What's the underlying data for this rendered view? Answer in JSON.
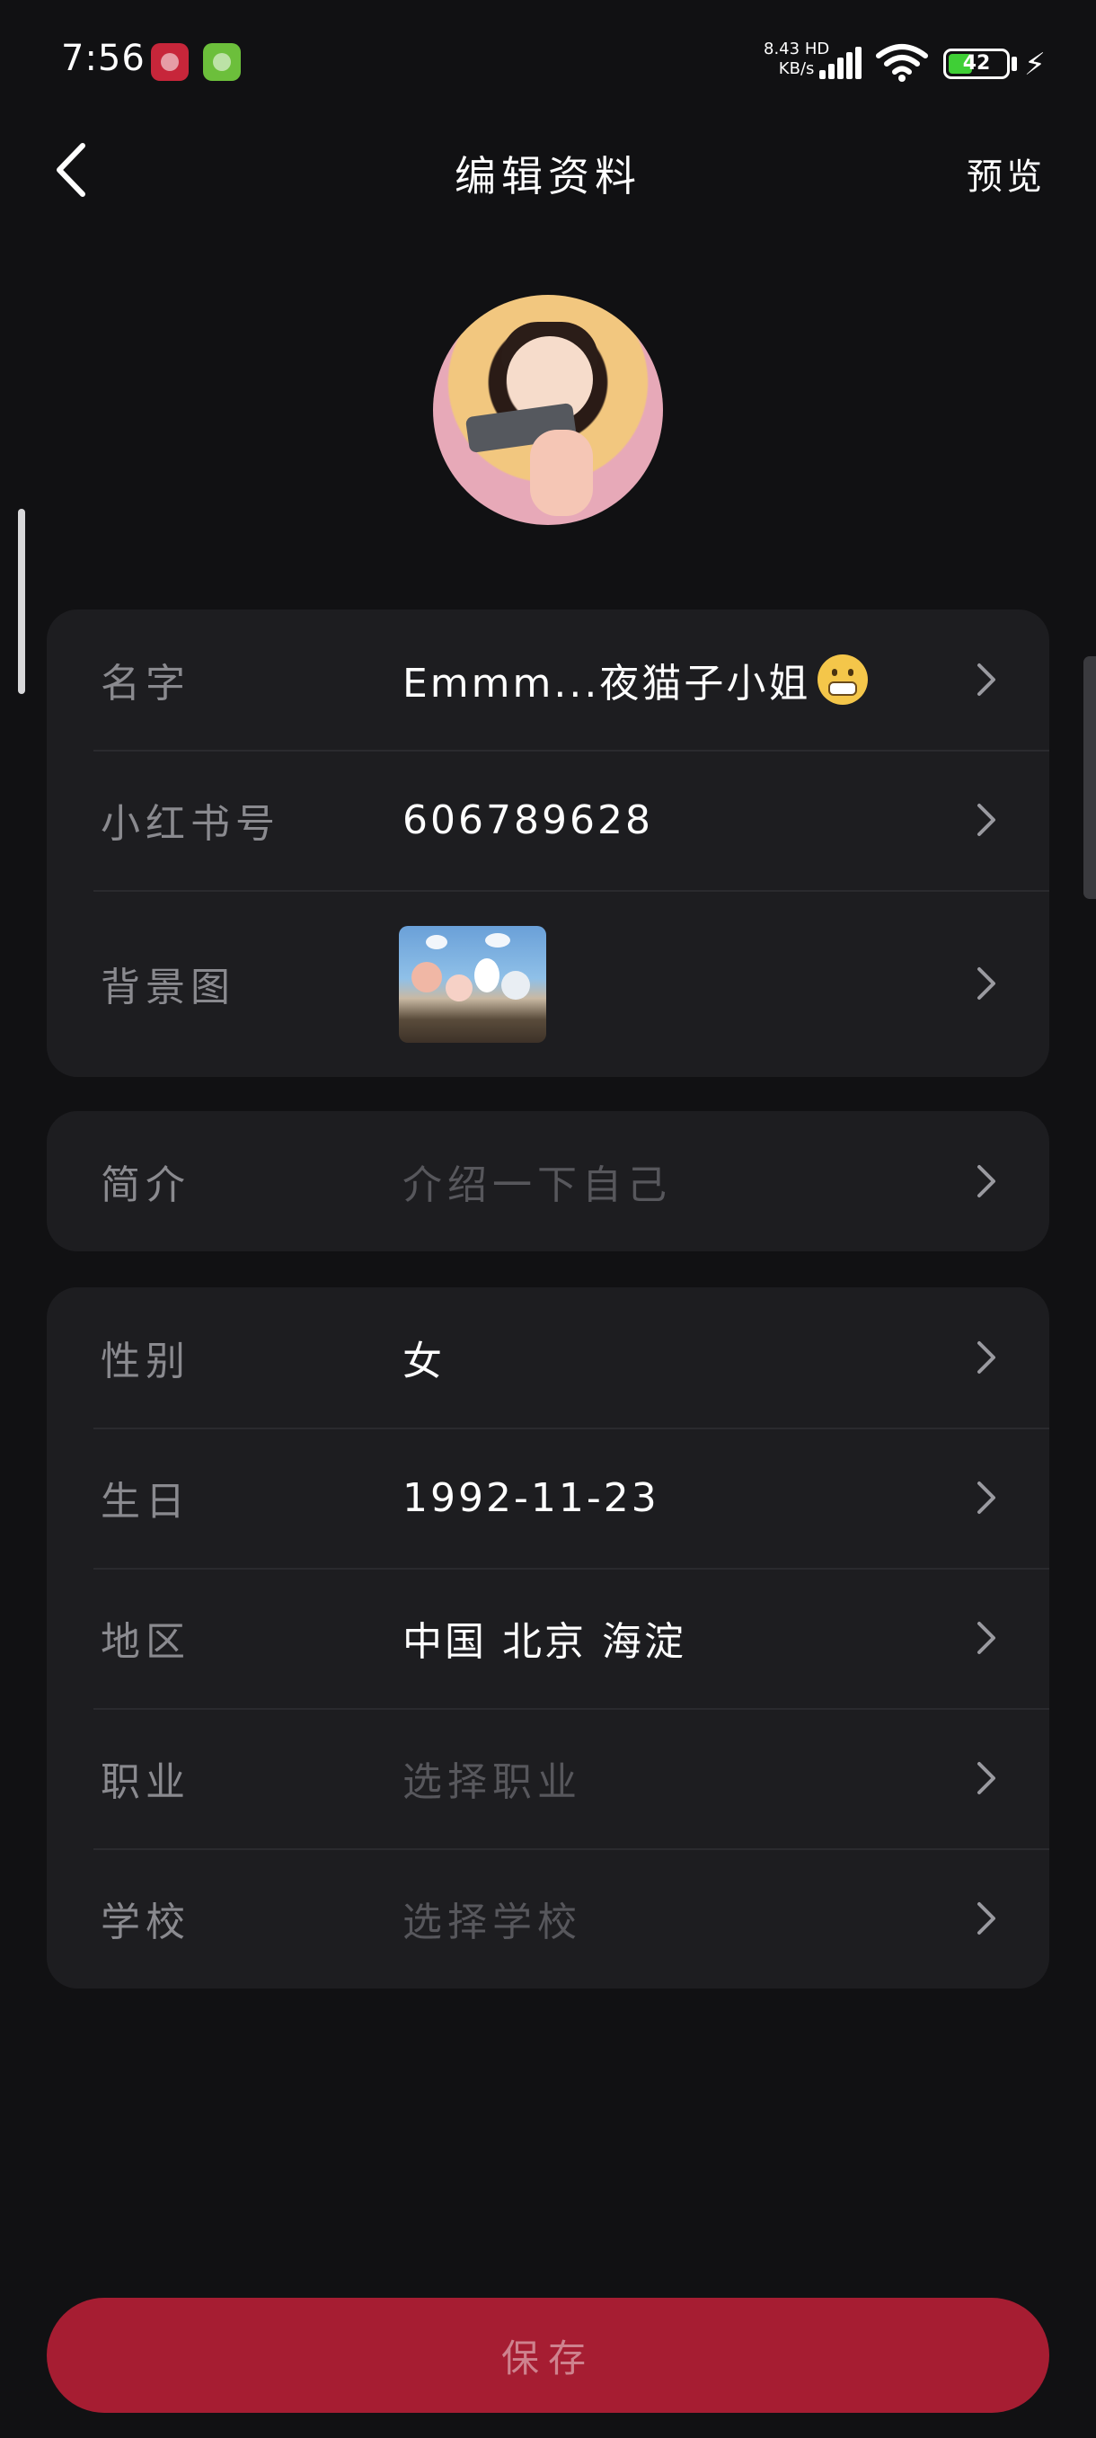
{
  "status_bar": {
    "time": "7:56",
    "net_speed_value": "8.43",
    "net_speed_unit": "KB/s",
    "network_type": "HD",
    "battery_level": "42",
    "battery_fraction": 0.42,
    "charging": true
  },
  "header": {
    "title": "编辑资料",
    "preview_label": "预览"
  },
  "profile_card": {
    "name_label": "名字",
    "name_value": "Emmm...夜猫子小姐",
    "id_label": "小红书号",
    "id_value": "606789628",
    "background_label": "背景图"
  },
  "bio_card": {
    "bio_label": "简介",
    "bio_placeholder": "介绍一下自己"
  },
  "info_card": {
    "gender_label": "性别",
    "gender_value": "女",
    "birthday_label": "生日",
    "birthday_value": "1992-11-23",
    "region_label": "地区",
    "region_value": "中国 北京 海淀",
    "job_label": "职业",
    "job_placeholder": "选择职业",
    "school_label": "学校",
    "school_placeholder": "选择学校"
  },
  "save_label": "保存",
  "colors": {
    "background": "#111113",
    "card": "#1d1d20",
    "save_button": "#a61d32",
    "label_text": "#8a8a8f",
    "placeholder_text": "#57575c"
  },
  "icons": [
    "back-arrow-icon",
    "chevron-right-icon",
    "grimace-emoji-icon",
    "wifi-icon",
    "signal-icon",
    "battery-icon",
    "charging-icon"
  ]
}
